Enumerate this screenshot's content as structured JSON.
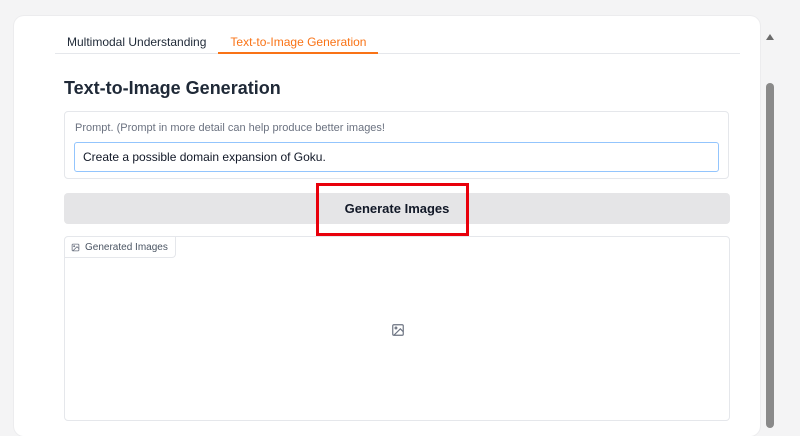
{
  "tabs": [
    {
      "label": "Multimodal Understanding",
      "active": false
    },
    {
      "label": "Text-to-Image Generation",
      "active": true
    }
  ],
  "main": {
    "title": "Text-to-Image Generation",
    "prompt": {
      "label": "Prompt. (Prompt in more detail can help produce better images!",
      "value": "Create a possible domain expansion of Goku."
    },
    "generate_button": "Generate Images",
    "gallery": {
      "label": "Generated Images",
      "label_icon": "image-icon",
      "placeholder_icon": "image-icon"
    }
  },
  "colors": {
    "accent": "#f97316",
    "highlight_box": "#e8000b",
    "button_bg": "#e5e5e7",
    "input_focus_border": "#93c5fd"
  }
}
